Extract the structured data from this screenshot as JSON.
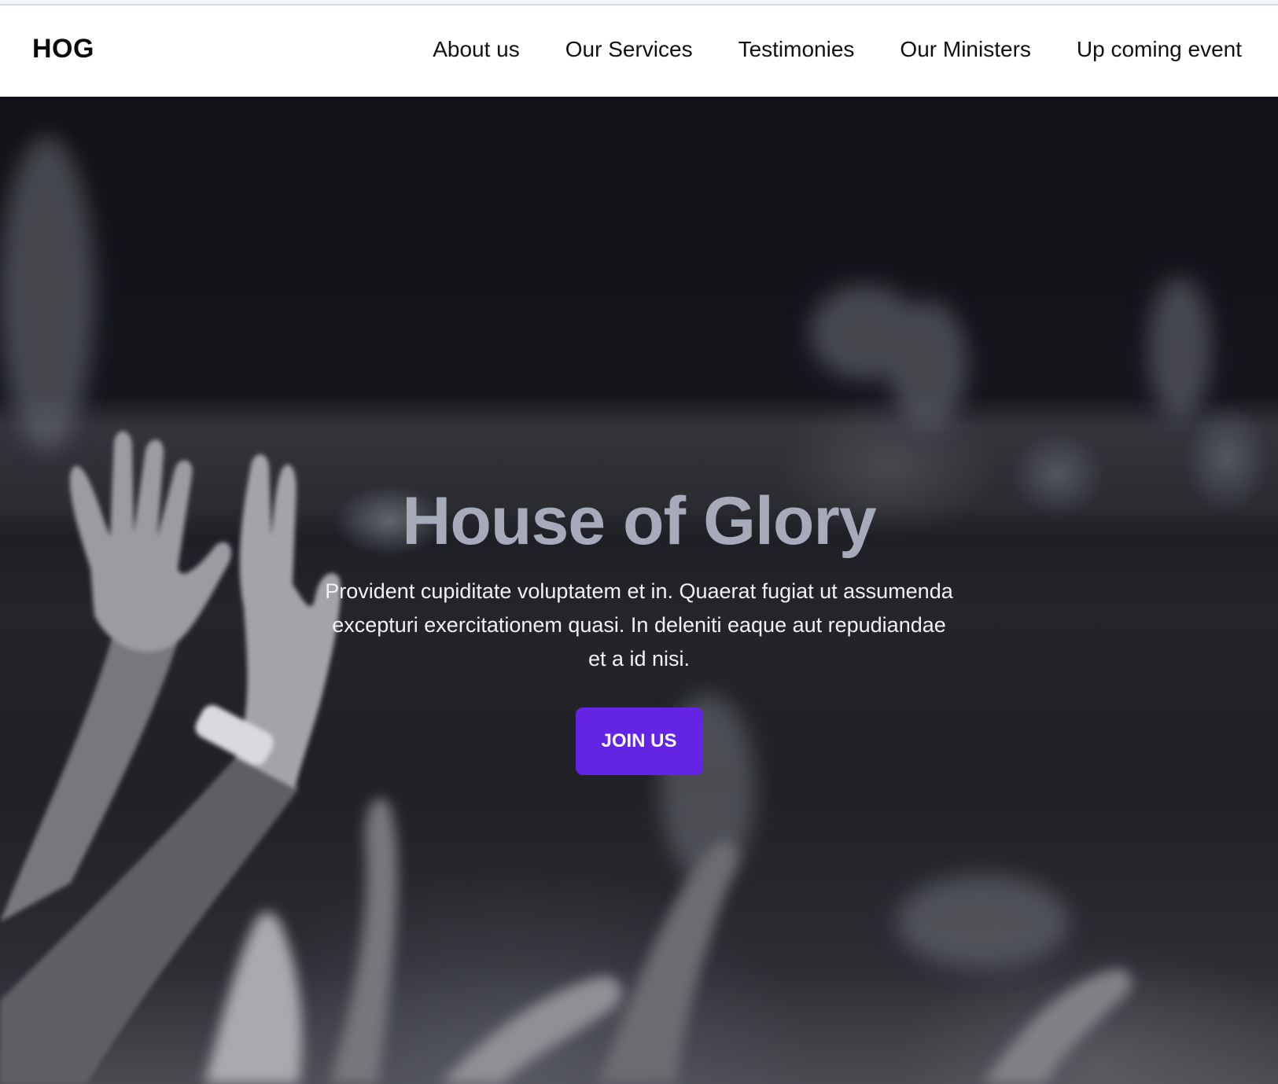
{
  "navbar": {
    "brand": "HOG",
    "links": [
      {
        "label": "About us"
      },
      {
        "label": "Our Services"
      },
      {
        "label": "Testimonies"
      },
      {
        "label": "Our Ministers"
      },
      {
        "label": "Up coming event"
      }
    ]
  },
  "hero": {
    "title": "House of Glory",
    "text": "Provident cupiditate voluptatem et in. Quaerat fugiat ut assumenda excepturi exercitationem quasi. In deleniti eaque aut repudiandae et a id nisi.",
    "cta_label": "JOIN US",
    "background_image": "grayscale-photo-of-raised-hands"
  },
  "colors": {
    "accent": "#6325e3",
    "title_color": "#a6abba",
    "hero_dark": "#101217"
  }
}
